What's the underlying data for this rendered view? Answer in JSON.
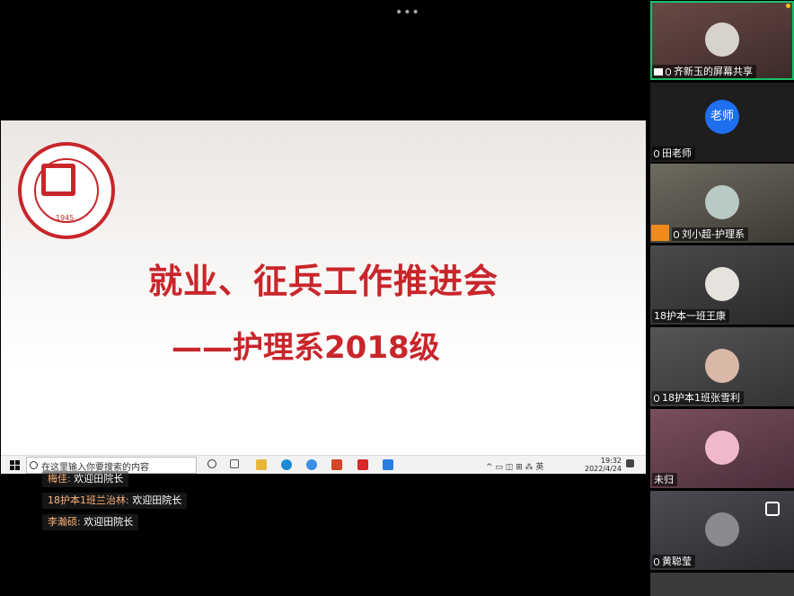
{
  "top": {
    "more_glyph": "•••"
  },
  "slide": {
    "title": "就业、征兵工作推进会",
    "subtitle": "——护理系2018级",
    "logo_year": "1945"
  },
  "taskbar": {
    "search_placeholder": "在这里输入你要搜索的内容",
    "tray_text": "^ ▭ ◫ ⊞ ⁂ 英",
    "time": "19:32",
    "date": "2022/4/24"
  },
  "chat": [
    {
      "name": "梅佳:",
      "message": "欢迎田院长"
    },
    {
      "name": "18护本1班兰治林:",
      "message": "欢迎田院长"
    },
    {
      "name": "李瀚硕:",
      "message": "欢迎田院长"
    }
  ],
  "participants": [
    {
      "label": "齐新玉的屏幕共享"
    },
    {
      "label": "田老师",
      "avatar_text": "老师"
    },
    {
      "label": "刘小超-护理系"
    },
    {
      "label": "18护本一班王康"
    },
    {
      "label": "18护本1班张雪利"
    },
    {
      "label": "未归"
    },
    {
      "label": "黄聪莹"
    }
  ],
  "colors": {
    "accent": "#c8262b",
    "active_border": "#1ac06a",
    "teacher_avatar": "#1e6ff0"
  }
}
